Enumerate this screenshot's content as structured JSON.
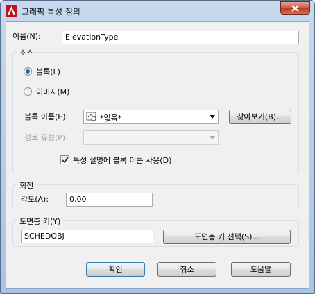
{
  "window": {
    "title": "그래픽 특성 정의"
  },
  "name_field": {
    "label": "이름(N):",
    "value": "ElevationType"
  },
  "source_group": {
    "title": "소스",
    "radio_block": "블록(L)",
    "radio_image": "이미지(M)",
    "selected": "블록(L)"
  },
  "block_name": {
    "label": "블록 이름(E):",
    "value": "*없음*",
    "browse_button": "찾아보기(B)..."
  },
  "path_type": {
    "label": "경로 유형(P):",
    "value": ""
  },
  "use_block_name_checkbox": {
    "label": "특성 설명에 블록 이름 사용(D)",
    "checked": true
  },
  "rotation_group": {
    "title": "회전",
    "angle_label": "각도(A):",
    "angle_value": "0,00"
  },
  "layer_key_group": {
    "title": "도면층 키(Y)",
    "value": "SCHEDOBJ",
    "select_button": "도면층 키 선택(S)..."
  },
  "footer": {
    "ok_button": "확인",
    "cancel_button": "취소",
    "help_button": "도움말"
  },
  "colors": {
    "title_bar": "#a9c4e2",
    "app_icon": "#c0141a",
    "close_button": "#c75a44"
  }
}
